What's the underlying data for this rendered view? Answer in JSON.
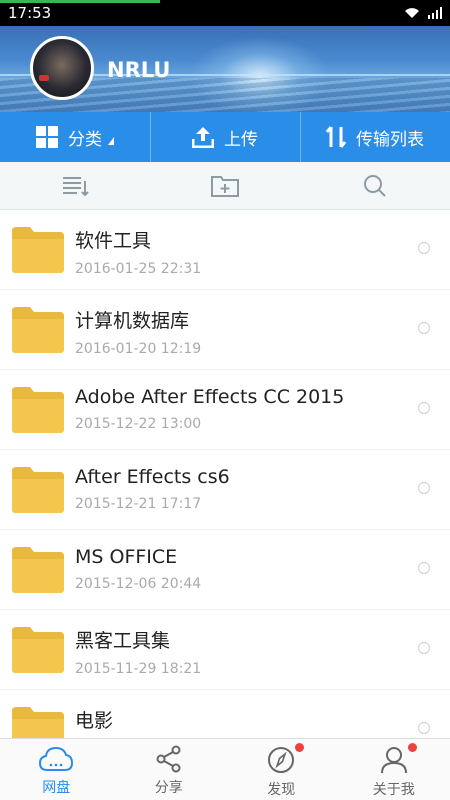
{
  "status_bar": {
    "time": "17:53"
  },
  "header": {
    "username": "NRLU"
  },
  "action_bar": {
    "category_label": "分类",
    "upload_label": "上传",
    "transfer_label": "传输列表"
  },
  "files": [
    {
      "name": "软件工具",
      "date": "2016-01-25  22:31"
    },
    {
      "name": "计算机数据库",
      "date": "2016-01-20  12:19"
    },
    {
      "name": "Adobe After Effects CC 2015",
      "date": "2015-12-22  13:00"
    },
    {
      "name": "After Effects cs6",
      "date": "2015-12-21  17:17"
    },
    {
      "name": "MS OFFICE",
      "date": "2015-12-06  20:44"
    },
    {
      "name": "黑客工具集",
      "date": "2015-11-29  18:21"
    },
    {
      "name": "电影",
      "date": ""
    }
  ],
  "bottom_nav": [
    {
      "label": "网盘",
      "icon": "cloud-icon"
    },
    {
      "label": "分享",
      "icon": "share-icon"
    },
    {
      "label": "发现",
      "icon": "compass-icon"
    },
    {
      "label": "关于我",
      "icon": "user-icon"
    }
  ],
  "colors": {
    "accent": "#2a8ee8",
    "folder": "#f3c64e",
    "badge": "#f04040"
  }
}
